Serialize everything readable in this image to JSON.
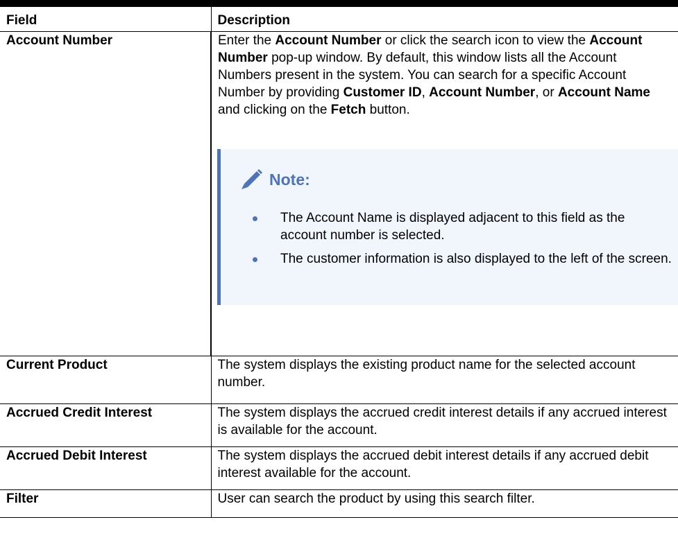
{
  "table": {
    "header": {
      "field": "Field",
      "description": "Description"
    },
    "rows": [
      {
        "field": "Account Number",
        "description_parts": [
          "Enter the ",
          "Account Number",
          " or click the search icon to view the ",
          "Account Number",
          " pop-up window. By default, this window lists all the Account Numbers present in the system. You can search for a specific Account Number by providing ",
          "Customer ID",
          ", ",
          "Account Number",
          ", or ",
          "Account Name",
          " and clicking on the ",
          "Fetch",
          " button."
        ],
        "note": {
          "title": "Note:",
          "icon": "pencil-icon",
          "items": [
            "The Account Name is displayed adjacent to this field as the account number is selected.",
            "The customer information is also displayed to the left of the screen."
          ]
        }
      },
      {
        "field": "Current Product",
        "description": "The system displays the existing product name for the selected account number."
      },
      {
        "field": "Accrued Credit Interest",
        "description": "The system displays the accrued credit interest details if any accrued interest is available for the account."
      },
      {
        "field": "Accrued Debit Interest",
        "description": "The system displays the accrued debit interest details if any accrued debit interest available for the account."
      },
      {
        "field": "Filter",
        "description": "User can search the product by using this search filter."
      }
    ]
  },
  "colors": {
    "accent": "#4d74b9",
    "note_bg": "#f0f6fc",
    "border": "#000000"
  }
}
